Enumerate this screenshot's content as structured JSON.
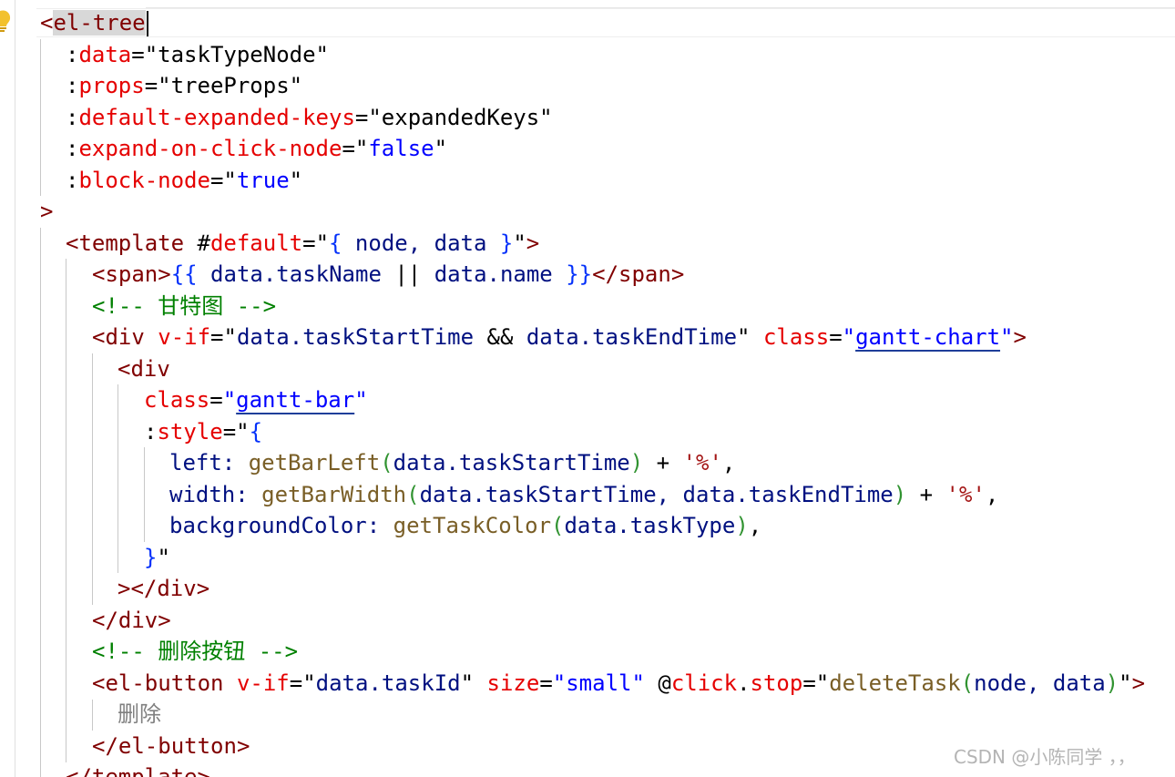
{
  "colors": {
    "tag": "#800000",
    "attribute": "#e50000",
    "string": "#0000ff",
    "variable": "#001080",
    "function": "#795e26",
    "brace": "#0431fa",
    "paren": "#319331",
    "comment": "#008000",
    "quoted_string": "#a31515",
    "underline": "#1f3e99",
    "indent_guide": "#c8c8c8",
    "watermark": "#b4b4b4"
  },
  "icons": {
    "lightbulb": "lightbulb-icon"
  },
  "watermark": "CSDN @小陈同学 ，，",
  "lines": [
    {
      "tokens": [
        {
          "t": "<",
          "c": "tag"
        },
        {
          "t": "el-tree",
          "c": "tag",
          "hl": true
        },
        {
          "t": "",
          "caret": true
        }
      ]
    },
    {
      "tokens": [
        {
          "t": ":",
          "c": "punct"
        },
        {
          "t": "data",
          "c": "attr"
        },
        {
          "t": "=",
          "c": "punct"
        },
        {
          "t": "\"taskTypeNode\"",
          "c": "punct"
        }
      ]
    },
    {
      "tokens": [
        {
          "t": ":",
          "c": "punct"
        },
        {
          "t": "props",
          "c": "attr"
        },
        {
          "t": "=",
          "c": "punct"
        },
        {
          "t": "\"treeProps\"",
          "c": "punct"
        }
      ]
    },
    {
      "tokens": [
        {
          "t": ":",
          "c": "punct"
        },
        {
          "t": "default-expanded-keys",
          "c": "attr"
        },
        {
          "t": "=",
          "c": "punct"
        },
        {
          "t": "\"expandedKeys\"",
          "c": "punct"
        }
      ]
    },
    {
      "tokens": [
        {
          "t": ":",
          "c": "punct"
        },
        {
          "t": "expand-on-click-node",
          "c": "attr"
        },
        {
          "t": "=",
          "c": "punct"
        },
        {
          "t": "\"",
          "c": "punct"
        },
        {
          "t": "false",
          "c": "str"
        },
        {
          "t": "\"",
          "c": "punct"
        }
      ]
    },
    {
      "tokens": [
        {
          "t": ":",
          "c": "punct"
        },
        {
          "t": "block-node",
          "c": "attr"
        },
        {
          "t": "=",
          "c": "punct"
        },
        {
          "t": "\"",
          "c": "punct"
        },
        {
          "t": "true",
          "c": "str"
        },
        {
          "t": "\"",
          "c": "punct"
        }
      ]
    },
    {
      "tokens": [
        {
          "t": ">",
          "c": "tag"
        }
      ]
    },
    {
      "tokens": [
        {
          "t": "<template ",
          "c": "tag"
        },
        {
          "t": "#",
          "c": "punct"
        },
        {
          "t": "default",
          "c": "attr"
        },
        {
          "t": "=",
          "c": "punct"
        },
        {
          "t": "\"",
          "c": "punct"
        },
        {
          "t": "{",
          "c": "brace"
        },
        {
          "t": " node, data ",
          "c": "var"
        },
        {
          "t": "}",
          "c": "brace"
        },
        {
          "t": "\"",
          "c": "punct"
        },
        {
          "t": ">",
          "c": "tag"
        }
      ]
    },
    {
      "tokens": [
        {
          "t": "<span>",
          "c": "tag"
        },
        {
          "t": "{{",
          "c": "brace"
        },
        {
          "t": " data.taskName ",
          "c": "var"
        },
        {
          "t": "||",
          "c": "punct"
        },
        {
          "t": " data.name ",
          "c": "var"
        },
        {
          "t": "}}",
          "c": "brace"
        },
        {
          "t": "</span>",
          "c": "tag"
        }
      ]
    },
    {
      "tokens": [
        {
          "t": "<!-- ",
          "c": "cmt"
        },
        {
          "t": "甘特图",
          "c": "cmt",
          "cjk": true
        },
        {
          "t": " -->",
          "c": "cmt"
        }
      ]
    },
    {
      "tokens": [
        {
          "t": "<div ",
          "c": "tag"
        },
        {
          "t": "v-if",
          "c": "attr"
        },
        {
          "t": "=",
          "c": "punct"
        },
        {
          "t": "\"",
          "c": "punct"
        },
        {
          "t": "data.taskStartTime",
          "c": "var"
        },
        {
          "t": " && ",
          "c": "punct"
        },
        {
          "t": "data.taskEndTime",
          "c": "var"
        },
        {
          "t": "\" ",
          "c": "punct"
        },
        {
          "t": "class",
          "c": "attr"
        },
        {
          "t": "=",
          "c": "punct"
        },
        {
          "t": "\"",
          "c": "str"
        },
        {
          "t": "gantt-chart",
          "c": "str",
          "u": true
        },
        {
          "t": "\"",
          "c": "str"
        },
        {
          "t": ">",
          "c": "tag"
        }
      ]
    },
    {
      "tokens": [
        {
          "t": "<div",
          "c": "tag"
        }
      ]
    },
    {
      "tokens": [
        {
          "t": "class",
          "c": "attr"
        },
        {
          "t": "=",
          "c": "punct"
        },
        {
          "t": "\"",
          "c": "str"
        },
        {
          "t": "gantt-bar",
          "c": "str",
          "u": true
        },
        {
          "t": "\"",
          "c": "str"
        }
      ]
    },
    {
      "tokens": [
        {
          "t": ":",
          "c": "punct"
        },
        {
          "t": "style",
          "c": "attr"
        },
        {
          "t": "=",
          "c": "punct"
        },
        {
          "t": "\"",
          "c": "punct"
        },
        {
          "t": "{",
          "c": "brace"
        }
      ]
    },
    {
      "tokens": [
        {
          "t": "left: ",
          "c": "var"
        },
        {
          "t": "getBarLeft",
          "c": "fn"
        },
        {
          "t": "(",
          "c": "paren"
        },
        {
          "t": "data.taskStartTime",
          "c": "var"
        },
        {
          "t": ")",
          "c": "paren"
        },
        {
          "t": " + ",
          "c": "punct"
        },
        {
          "t": "'%'",
          "c": "strq"
        },
        {
          "t": ",",
          "c": "punct"
        }
      ]
    },
    {
      "tokens": [
        {
          "t": "width: ",
          "c": "var"
        },
        {
          "t": "getBarWidth",
          "c": "fn"
        },
        {
          "t": "(",
          "c": "paren"
        },
        {
          "t": "data.taskStartTime, data.taskEndTime",
          "c": "var"
        },
        {
          "t": ")",
          "c": "paren"
        },
        {
          "t": " + ",
          "c": "punct"
        },
        {
          "t": "'%'",
          "c": "strq"
        },
        {
          "t": ",",
          "c": "punct"
        }
      ]
    },
    {
      "tokens": [
        {
          "t": "backgroundColor: ",
          "c": "var"
        },
        {
          "t": "getTaskColor",
          "c": "fn"
        },
        {
          "t": "(",
          "c": "paren"
        },
        {
          "t": "data.taskType",
          "c": "var"
        },
        {
          "t": ")",
          "c": "paren"
        },
        {
          "t": ",",
          "c": "punct"
        }
      ]
    },
    {
      "tokens": [
        {
          "t": "}",
          "c": "brace"
        },
        {
          "t": "\"",
          "c": "punct"
        }
      ]
    },
    {
      "tokens": [
        {
          "t": "></div>",
          "c": "tag"
        }
      ]
    },
    {
      "tokens": [
        {
          "t": "</div>",
          "c": "tag"
        }
      ]
    },
    {
      "tokens": [
        {
          "t": "<!-- ",
          "c": "cmt"
        },
        {
          "t": "删除按钮",
          "c": "cmt",
          "cjk": true
        },
        {
          "t": " -->",
          "c": "cmt"
        }
      ]
    },
    {
      "tokens": [
        {
          "t": "<el-button ",
          "c": "tag"
        },
        {
          "t": "v-if",
          "c": "attr"
        },
        {
          "t": "=",
          "c": "punct"
        },
        {
          "t": "\"",
          "c": "punct"
        },
        {
          "t": "data.taskId",
          "c": "var"
        },
        {
          "t": "\" ",
          "c": "punct"
        },
        {
          "t": "size",
          "c": "attr"
        },
        {
          "t": "=",
          "c": "punct"
        },
        {
          "t": "\"small\" ",
          "c": "str"
        },
        {
          "t": "@",
          "c": "punct"
        },
        {
          "t": "click",
          "c": "attr"
        },
        {
          "t": ".",
          "c": "punct"
        },
        {
          "t": "stop",
          "c": "attr"
        },
        {
          "t": "=",
          "c": "punct"
        },
        {
          "t": "\"",
          "c": "punct"
        },
        {
          "t": "deleteTask",
          "c": "fn"
        },
        {
          "t": "(",
          "c": "paren"
        },
        {
          "t": "node, data",
          "c": "var"
        },
        {
          "t": ")",
          "c": "paren"
        },
        {
          "t": "\"",
          "c": "punct"
        },
        {
          "t": ">",
          "c": "tag"
        }
      ]
    },
    {
      "tokens": [
        {
          "t": "删除",
          "c": "cjk"
        }
      ]
    },
    {
      "tokens": [
        {
          "t": "</el-button>",
          "c": "tag"
        }
      ]
    },
    {
      "tokens": [
        {
          "t": "</template>",
          "c": "tag"
        }
      ]
    }
  ]
}
